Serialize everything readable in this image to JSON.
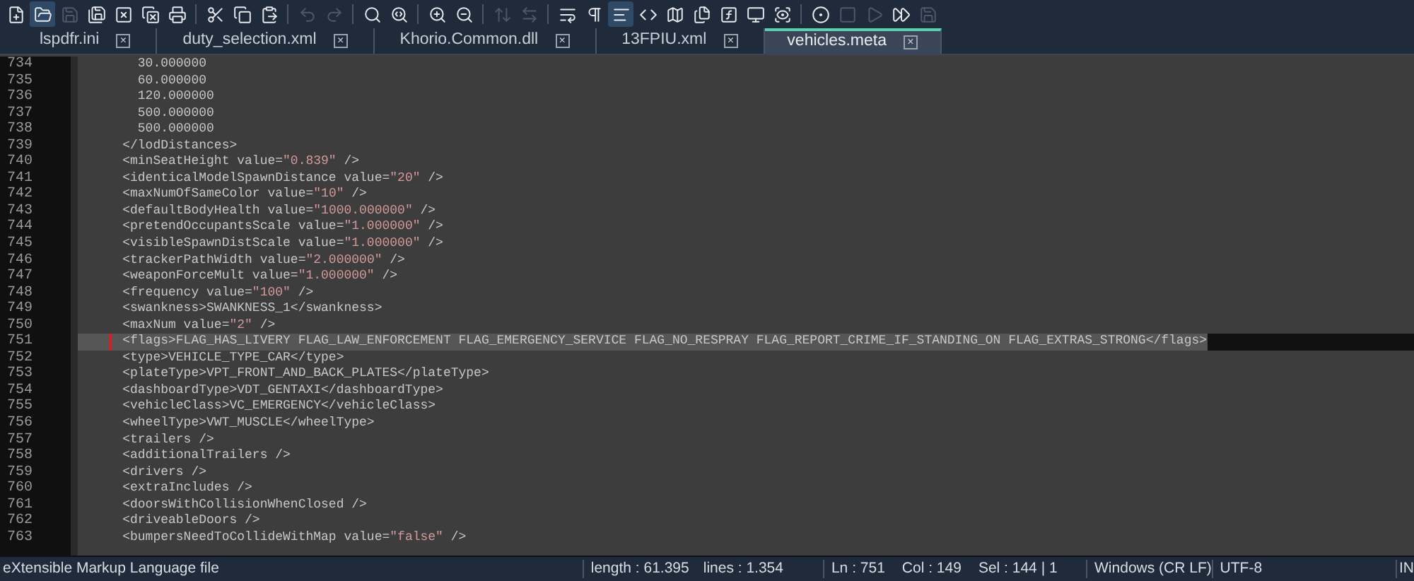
{
  "toolbar": [
    {
      "kind": "button",
      "disabled": false,
      "selected": false
    },
    {
      "kind": "button",
      "disabled": false,
      "selected": true
    },
    {
      "kind": "button",
      "disabled": true,
      "selected": false
    },
    {
      "kind": "button",
      "disabled": false,
      "selected": false
    },
    {
      "kind": "button",
      "disabled": false,
      "selected": false
    },
    {
      "kind": "button",
      "disabled": false,
      "selected": false
    },
    {
      "kind": "button",
      "disabled": false,
      "selected": false
    },
    {
      "kind": "separator"
    },
    {
      "kind": "button",
      "disabled": false,
      "selected": false
    },
    {
      "kind": "button",
      "disabled": false,
      "selected": false
    },
    {
      "kind": "button",
      "disabled": false,
      "selected": false
    },
    {
      "kind": "separator"
    },
    {
      "kind": "button",
      "disabled": true,
      "selected": false
    },
    {
      "kind": "button",
      "disabled": true,
      "selected": false
    },
    {
      "kind": "separator"
    },
    {
      "kind": "button",
      "disabled": false,
      "selected": false
    },
    {
      "kind": "button",
      "disabled": false,
      "selected": false
    },
    {
      "kind": "separator"
    },
    {
      "kind": "button",
      "disabled": false,
      "selected": false
    },
    {
      "kind": "button",
      "disabled": false,
      "selected": false
    },
    {
      "kind": "separator"
    },
    {
      "kind": "button",
      "disabled": true,
      "selected": false
    },
    {
      "kind": "button",
      "disabled": true,
      "selected": false
    },
    {
      "kind": "separator"
    },
    {
      "kind": "button",
      "disabled": false,
      "selected": false
    },
    {
      "kind": "button",
      "disabled": false,
      "selected": false
    },
    {
      "kind": "button",
      "disabled": false,
      "selected": true
    },
    {
      "kind": "button",
      "disabled": false,
      "selected": false
    },
    {
      "kind": "button",
      "disabled": false,
      "selected": false
    },
    {
      "kind": "button",
      "disabled": false,
      "selected": false
    },
    {
      "kind": "button",
      "disabled": false,
      "selected": false
    },
    {
      "kind": "button",
      "disabled": false,
      "selected": false
    },
    {
      "kind": "button",
      "disabled": false,
      "selected": false
    },
    {
      "kind": "separator"
    },
    {
      "kind": "button",
      "disabled": false,
      "selected": false
    },
    {
      "kind": "button",
      "disabled": true,
      "selected": false
    },
    {
      "kind": "button",
      "disabled": true,
      "selected": false
    },
    {
      "kind": "button",
      "disabled": false,
      "selected": false
    },
    {
      "kind": "button",
      "disabled": true,
      "selected": false
    }
  ],
  "tabs": [
    {
      "label": "lspdfr.ini",
      "close": "×",
      "selected": false
    },
    {
      "label": "duty_selection.xml",
      "close": "×",
      "selected": false
    },
    {
      "label": "Khorio.Common.dll",
      "close": "×",
      "selected": false
    },
    {
      "label": "13FPIU.xml",
      "close": "×",
      "selected": false
    },
    {
      "label": "vehicles.meta",
      "close": "×",
      "selected": true
    }
  ],
  "editor": {
    "lines": [
      {
        "number": "734",
        "text": "      30.000000",
        "selected": false
      },
      {
        "number": "735",
        "text": "      60.000000",
        "selected": false
      },
      {
        "number": "736",
        "text": "      120.000000",
        "selected": false
      },
      {
        "number": "737",
        "text": "      500.000000",
        "selected": false
      },
      {
        "number": "738",
        "text": "      500.000000",
        "selected": false
      },
      {
        "number": "739",
        "text": "    </lodDistances>",
        "selected": false
      },
      {
        "number": "740",
        "text": "    <minSeatHeight value=\"0.839\" />",
        "selected": false
      },
      {
        "number": "741",
        "text": "    <identicalModelSpawnDistance value=\"20\" />",
        "selected": false
      },
      {
        "number": "742",
        "text": "    <maxNumOfSameColor value=\"10\" />",
        "selected": false
      },
      {
        "number": "743",
        "text": "    <defaultBodyHealth value=\"1000.000000\" />",
        "selected": false
      },
      {
        "number": "744",
        "text": "    <pretendOccupantsScale value=\"1.000000\" />",
        "selected": false
      },
      {
        "number": "745",
        "text": "    <visibleSpawnDistScale value=\"1.000000\" />",
        "selected": false
      },
      {
        "number": "746",
        "text": "    <trackerPathWidth value=\"2.000000\" />",
        "selected": false
      },
      {
        "number": "747",
        "text": "    <weaponForceMult value=\"1.000000\" />",
        "selected": false
      },
      {
        "number": "748",
        "text": "    <frequency value=\"100\" />",
        "selected": false
      },
      {
        "number": "749",
        "text": "    <swankness>SWANKNESS_1</swankness>",
        "selected": false
      },
      {
        "number": "750",
        "text": "    <maxNum value=\"2\" />",
        "selected": false
      },
      {
        "number": "751",
        "text": "    <flags>FLAG_HAS_LIVERY FLAG_LAW_ENFORCEMENT FLAG_EMERGENCY_SERVICE FLAG_NO_RESPRAY FLAG_REPORT_CRIME_IF_STANDING_ON FLAG_EXTRAS_STRONG</flags>",
        "selected": true
      },
      {
        "number": "752",
        "text": "    <type>VEHICLE_TYPE_CAR</type>",
        "selected": false
      },
      {
        "number": "753",
        "text": "    <plateType>VPT_FRONT_AND_BACK_PLATES</plateType>",
        "selected": false
      },
      {
        "number": "754",
        "text": "    <dashboardType>VDT_GENTAXI</dashboardType>",
        "selected": false
      },
      {
        "number": "755",
        "text": "    <vehicleClass>VC_EMERGENCY</vehicleClass>",
        "selected": false
      },
      {
        "number": "756",
        "text": "    <wheelType>VWT_MUSCLE</wheelType>",
        "selected": false
      },
      {
        "number": "757",
        "text": "    <trailers />",
        "selected": false
      },
      {
        "number": "758",
        "text": "    <additionalTrailers />",
        "selected": false
      },
      {
        "number": "759",
        "text": "    <drivers />",
        "selected": false
      },
      {
        "number": "760",
        "text": "    <extraIncludes />",
        "selected": false
      },
      {
        "number": "761",
        "text": "    <doorsWithCollisionWhenClosed />",
        "selected": false
      },
      {
        "number": "762",
        "text": "    <driveableDoors />",
        "selected": false
      },
      {
        "number": "763",
        "text": "    <bumpersNeedToCollideWithMap value=\"false\" />",
        "selected": false
      }
    ]
  },
  "status_bar": {
    "file_type": "eXtensible Markup Language file",
    "length": "length : 61.395",
    "lines": "lines : 1.354",
    "ln": "Ln : 751",
    "col": "Col : 149",
    "sel": "Sel : 144 | 1",
    "eol": "Windows (CR LF)",
    "encoding": "UTF-8",
    "mode": "IN"
  }
}
